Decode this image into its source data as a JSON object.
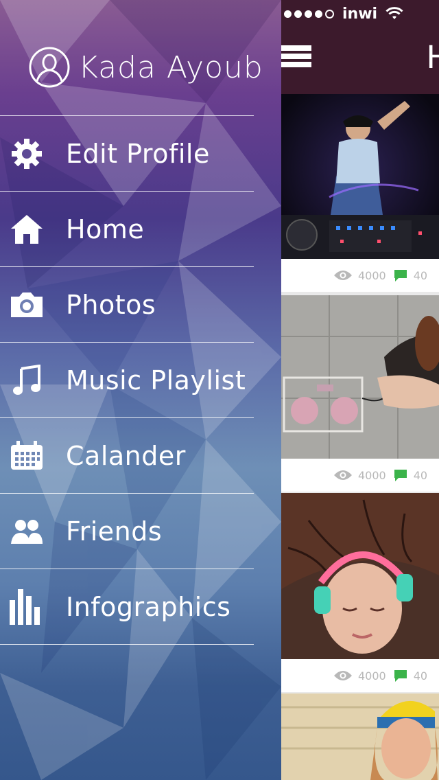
{
  "status_bar": {
    "carrier": "inwi"
  },
  "main": {
    "cards": [
      {
        "views": "4000",
        "comments": "40"
      },
      {
        "views": "4000",
        "comments": "40"
      },
      {
        "views": "4000",
        "comments": "40"
      }
    ]
  },
  "drawer": {
    "user_name": "Kada Ayoub",
    "items": [
      {
        "label": "Edit Profile",
        "icon": "gear-icon"
      },
      {
        "label": "Home",
        "icon": "home-icon"
      },
      {
        "label": "Photos",
        "icon": "camera-icon"
      },
      {
        "label": "Music Playlist",
        "icon": "music-note-icon"
      },
      {
        "label": "Calander",
        "icon": "calendar-icon"
      },
      {
        "label": "Friends",
        "icon": "friends-icon"
      },
      {
        "label": "Infographics",
        "icon": "bar-chart-icon"
      }
    ]
  },
  "colors": {
    "header_bg": "#3c1a2c",
    "comment_green": "#3bb34a",
    "stat_gray": "#b8b8b8"
  }
}
